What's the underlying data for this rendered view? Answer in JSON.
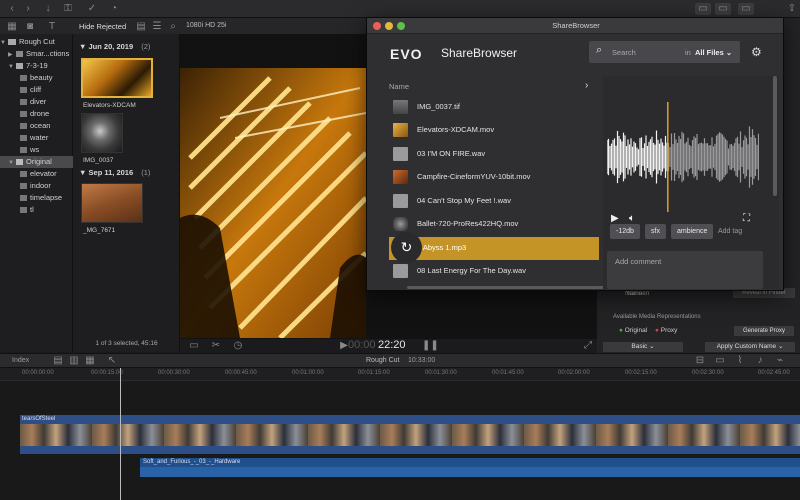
{
  "fcp": {
    "library": {
      "items": [
        {
          "label": "Rough Cut",
          "level": 0,
          "type": "library"
        },
        {
          "label": "Smar...ctions",
          "level": 1,
          "type": "folder"
        },
        {
          "label": "7-3-19",
          "level": 1,
          "type": "event"
        },
        {
          "label": "beauty",
          "level": 2,
          "type": "keyword"
        },
        {
          "label": "cliff",
          "level": 2,
          "type": "keyword"
        },
        {
          "label": "diver",
          "level": 2,
          "type": "keyword"
        },
        {
          "label": "drone",
          "level": 2,
          "type": "keyword"
        },
        {
          "label": "ocean",
          "level": 2,
          "type": "keyword"
        },
        {
          "label": "water",
          "level": 2,
          "type": "keyword"
        },
        {
          "label": "ws",
          "level": 2,
          "type": "keyword"
        },
        {
          "label": "Original",
          "level": 1,
          "type": "event",
          "selected": true
        },
        {
          "label": "elevator",
          "level": 2,
          "type": "keyword"
        },
        {
          "label": "indoor",
          "level": 2,
          "type": "keyword"
        },
        {
          "label": "timelapse",
          "level": 2,
          "type": "keyword"
        },
        {
          "label": "tl",
          "level": 2,
          "type": "keyword"
        }
      ]
    },
    "browser": {
      "filter": "Hide Rejected",
      "groups": [
        {
          "date": "Jun 20, 2019",
          "count": "(2)",
          "clips": [
            "Elevators-XDCAM",
            "IMG_0037"
          ]
        },
        {
          "date": "Sep 11, 2016",
          "count": "(1)",
          "clips": [
            "_MG_7671"
          ]
        }
      ],
      "selection_status": "1 of 3 selected, 45:16"
    },
    "viewer": {
      "format": "1080i HD 25i",
      "timecode_dim": "00:00",
      "timecode": "22:20"
    },
    "inspector": {
      "name_label": "Name",
      "name_value": "Nansen",
      "reveal_button": "Reveal in Finder",
      "media_reps_label": "Available Media Representations",
      "original": "Original",
      "proxy": "Proxy",
      "generate_proxy": "Generate Proxy",
      "basic": "Basic",
      "apply_custom_name": "Apply Custom Name"
    },
    "timeline": {
      "index": "Index",
      "project": "Rough Cut",
      "duration": "10:33:00",
      "ruler": [
        "00:00:00:00",
        "00:00:15:00",
        "00:00:30:00",
        "00:00:45:00",
        "00:01:00:00",
        "00:01:15:00",
        "00:01:30:00",
        "00:01:45:00",
        "00:02:00:00",
        "00:02:15:00",
        "00:02:30:00",
        "00:02:45:00"
      ],
      "video_clip": "tearsOfSteel",
      "audio_clip": "Soft_and_Furious_-_03_-_Hardware"
    }
  },
  "sharebrowser": {
    "window_title": "ShareBrowser",
    "logo": "EVO",
    "app_name": "ShareBrowser",
    "search_placeholder": "Search",
    "scope_prefix": "in",
    "scope_value": "All Files",
    "column_name": "Name",
    "files": [
      {
        "name": "IMG_0037.tif",
        "kind": "image"
      },
      {
        "name": "Elevators-XDCAM.mov",
        "kind": "video"
      },
      {
        "name": "03 I'M ON FIRE.wav",
        "kind": "audio"
      },
      {
        "name": "Campfire-CineformYUV-10bit.mov",
        "kind": "video"
      },
      {
        "name": "04 Can't Stop My Feet !.wav",
        "kind": "audio"
      },
      {
        "name": "Ballet-720-ProRes422HQ.mov",
        "kind": "video"
      },
      {
        "name": "5 Abyss 1.mp3",
        "kind": "audio",
        "selected": true
      },
      {
        "name": "08 Last Energy For The Day.wav",
        "kind": "audio"
      }
    ],
    "tags": [
      "-12db",
      "sfx",
      "ambience"
    ],
    "add_tag": "Add tag",
    "add_comment": "Add comment",
    "waveform_progress": 0.4,
    "colors": {
      "accent": "#c59426",
      "playhead": "#d9a227"
    }
  }
}
